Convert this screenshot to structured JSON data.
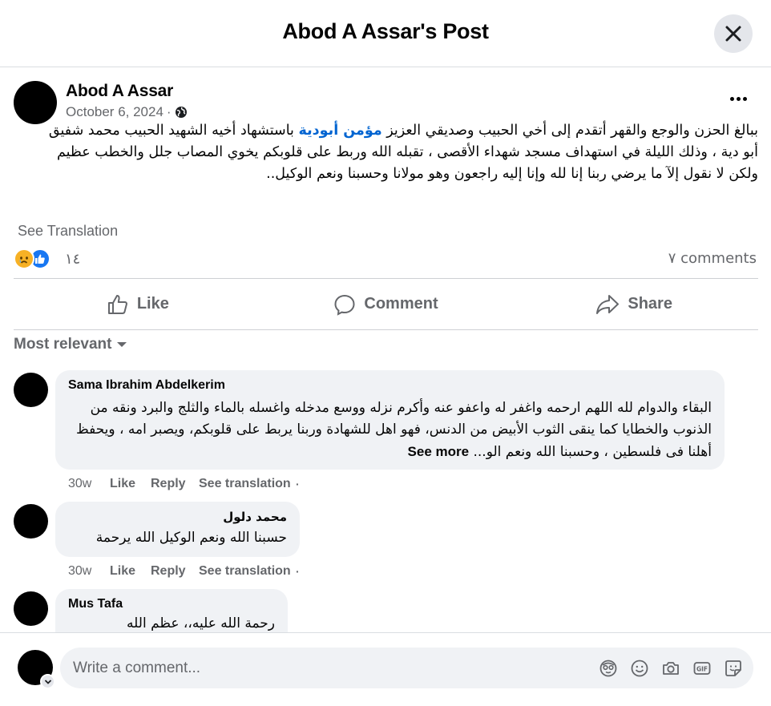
{
  "header": {
    "title": "Abod A Assar's Post",
    "close_icon": "close-icon"
  },
  "post": {
    "author": "Abod A Assar",
    "date": "October 6, 2024",
    "separator": "·",
    "privacy_icon": "globe-icon",
    "text_part1": "ببالغ الحزن والوجع والقهر أتقدم إلى أخي الحبيب وصديقي العزيز ",
    "mention": "مؤمن أبودية",
    "text_part2": " باستشهاد أخيه الشهيد الحبيب محمد شفيق أبو دية ، وذلك الليلة في استهداف مسجد شهداء الأقصى ، تقبله الله وربط على قلوبكم يخوي المصاب جلل والخطب عظيم ولكن لا نقول إلآ ما يرضي ربنا إنا لله وإنا إليه راجعون وهو مولانا وحسبنا ونعم الوكيل..",
    "see_translation": "See Translation",
    "reaction_count": "١٤",
    "comments_count": "٧ comments",
    "reactions": [
      "sad-reaction-icon",
      "like-reaction-icon"
    ]
  },
  "actions": {
    "like": "Like",
    "comment": "Comment",
    "share": "Share"
  },
  "sort": {
    "label": "Most relevant"
  },
  "comments": [
    {
      "name": "Sama Ibrahim Abdelkerim",
      "text": "البقاء والدوام لله اللهم ارحمه واغفر له واعفو عنه وأكرم نزله ووسع مدخله واغسله بالماء والثلج والبرد ونقه من الذنوب والخطايا كما ينقى الثوب الأبيض من الدنس، فهو اهل للشهادة وربنا يربط على قلوبكم، ويصبر امه ، ويحفظ أهلنا فى فلسطين ، وحسبنا الله ونعم الو...",
      "see_more": "See more",
      "time": "30w",
      "like": "Like",
      "reply": "Reply",
      "see_translation": "See translation",
      "dot": "·"
    },
    {
      "name": "محمد دلول",
      "text": "حسبنا الله ونعم الوكيل الله يرحمة",
      "time": "30w",
      "like": "Like",
      "reply": "Reply",
      "see_translation": "See translation",
      "dot": "·"
    },
    {
      "name": "Mus Tafa",
      "text": "رحمة الله عليه،، عظم الله"
    }
  ],
  "composer": {
    "placeholder": "Write a comment...",
    "icons": [
      "avatar-sticker-icon",
      "emoji-icon",
      "camera-icon",
      "gif-icon",
      "sticker-icon"
    ]
  }
}
